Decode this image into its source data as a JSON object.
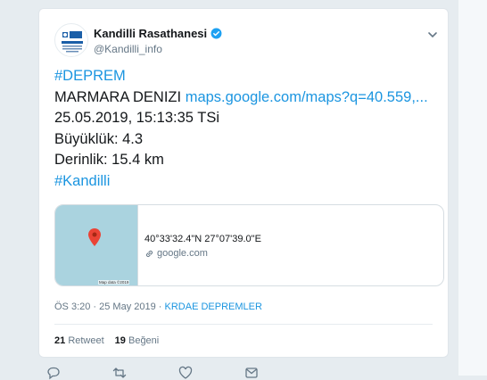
{
  "tweet": {
    "display_name": "Kandilli Rasathanesi",
    "handle": "@Kandilli_info",
    "line_hashtag1": "#DEPREM",
    "line_location": "MARMARA DENIZI",
    "line_link": "maps.google.com/maps?q=40.559,...",
    "line_datetime": "25.05.2019, 15:13:35 TSi",
    "line_magnitude": "Büyüklük: 4.3",
    "line_depth": "Derinlik: 15.4 km",
    "line_hashtag2": "#Kandilli"
  },
  "link_card": {
    "coords": "40°33'32.4\"N 27°07'39.0\"E",
    "domain": "google.com",
    "map_attribution": "Map data ©2019"
  },
  "meta": {
    "time": "ÖS 3:20 · 25 May 2019 · ",
    "app": "KRDAE DEPREMLER"
  },
  "stats": {
    "retweet_count": "21",
    "retweet_label": "Retweet",
    "like_count": "19",
    "like_label": "Beğeni"
  },
  "colors": {
    "link": "#1b95e0",
    "map_water": "#aad3df",
    "pin": "#ea4335"
  },
  "icons": [
    "verified-icon",
    "chevron-down-icon",
    "map-pin-icon",
    "link-icon",
    "reply-icon",
    "retweet-icon",
    "like-icon",
    "share-icon"
  ]
}
